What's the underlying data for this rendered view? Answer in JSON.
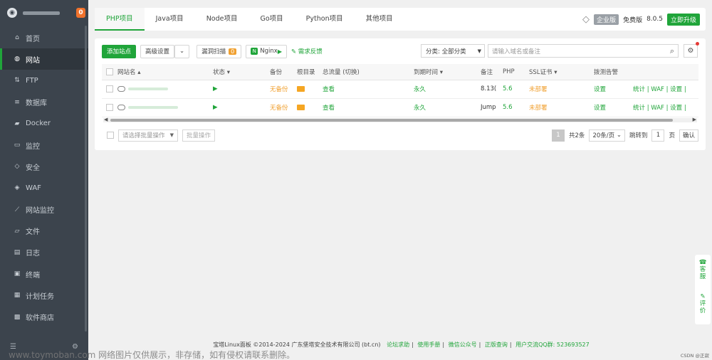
{
  "sidebar": {
    "badge": "0",
    "items": [
      {
        "label": "首页",
        "icon": "home-icon",
        "glyph": "⌂"
      },
      {
        "label": "网站",
        "icon": "globe-icon",
        "glyph": "◍"
      },
      {
        "label": "FTP",
        "icon": "ftp-icon",
        "glyph": "⇅"
      },
      {
        "label": "数据库",
        "icon": "database-icon",
        "glyph": "≡"
      },
      {
        "label": "Docker",
        "icon": "docker-icon",
        "glyph": "▰"
      },
      {
        "label": "监控",
        "icon": "monitor-icon",
        "glyph": "▭"
      },
      {
        "label": "安全",
        "icon": "shield-icon",
        "glyph": "◇"
      },
      {
        "label": "WAF",
        "icon": "waf-icon",
        "glyph": "◈"
      },
      {
        "label": "网站监控",
        "icon": "chart-icon",
        "glyph": "⟋"
      },
      {
        "label": "文件",
        "icon": "folder-icon",
        "glyph": "▱"
      },
      {
        "label": "日志",
        "icon": "log-icon",
        "glyph": "▤"
      },
      {
        "label": "终端",
        "icon": "terminal-icon",
        "glyph": "▣"
      },
      {
        "label": "计划任务",
        "icon": "cron-icon",
        "glyph": "▦"
      },
      {
        "label": "软件商店",
        "icon": "store-icon",
        "glyph": "▩"
      }
    ]
  },
  "tabs": [
    "PHP项目",
    "Java项目",
    "Node项目",
    "Go项目",
    "Python项目",
    "其他项目"
  ],
  "header": {
    "edition": "企业版",
    "free_label": "免费版",
    "version": "8.0.5",
    "upgrade": "立即升级"
  },
  "toolbar": {
    "add_site": "添加站点",
    "advanced": "高级设置",
    "scan": "漏洞扫描",
    "scan_count": "0",
    "nginx": "Nginx",
    "feedback": "需求反馈"
  },
  "filter": {
    "category": "分类: 全部分类",
    "search_placeholder": "请输入域名或备注"
  },
  "table": {
    "headers": [
      "网站名",
      "状态",
      "备份",
      "根目录",
      "总流量 (切换)",
      "到期时间",
      "备注",
      "PHP",
      "SSL证书",
      "拨测告警",
      ""
    ],
    "rows": [
      {
        "status": "▶",
        "backup": "无备份",
        "root": "查看",
        "expire": "永久",
        "note": "8.13(",
        "php": "5.6",
        "ssl": "未部署",
        "alert": "设置",
        "actions": "统计 | WAF | 设置 |"
      },
      {
        "status": "▶",
        "backup": "无备份",
        "root": "查看",
        "expire": "永久",
        "note": "Jump",
        "php": "5.6",
        "ssl": "未部署",
        "alert": "设置",
        "actions": "统计 | WAF | 设置 |"
      }
    ]
  },
  "footbar": {
    "batch_select": "请选择批量操作",
    "batch_btn": "批量操作",
    "page": "1",
    "total": "共2条",
    "per_page": "20条/页",
    "goto": "跳转到",
    "goto_page": "1",
    "page_unit": "页",
    "confirm": "确认"
  },
  "footer": {
    "copyright": "宝塔Linux面板 ©2014-2024 广东堡塔安全技术有限公司 (bt.cn)",
    "links": [
      "论坛求助",
      "使用手册",
      "微信公众号",
      "正版查询",
      "用户交流QQ群: 523693527"
    ]
  },
  "float": {
    "service": "客服",
    "review": "评价"
  },
  "csdn": "CSDN @正寂",
  "watermark": "www.toymoban.com 网络图片仅供展示，非存储，如有侵权请联系删除。",
  "colors": {
    "accent": "#20a53a",
    "warning": "#f0a030",
    "sidebar": "#3c444d"
  }
}
